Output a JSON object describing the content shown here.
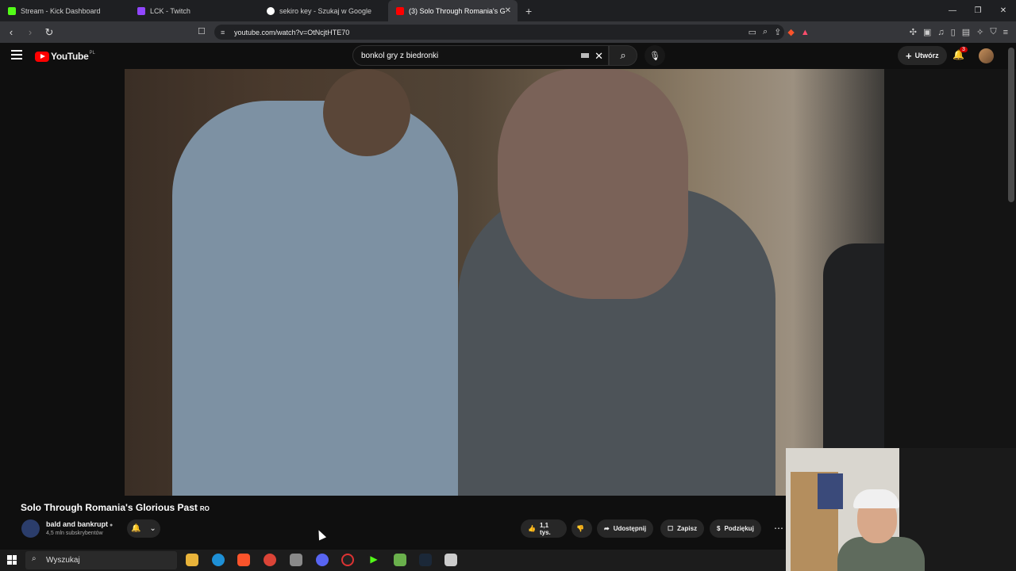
{
  "browser": {
    "tabs": [
      {
        "label": "Stream - Kick Dashboard",
        "favicon_color": "#53fc18"
      },
      {
        "label": "LCK - Twitch",
        "favicon_color": "#9146ff"
      },
      {
        "label": "sekiro key - Szukaj w Google",
        "favicon_color": "#ffffff"
      },
      {
        "label": "(3) Solo Through Romania's G",
        "favicon_color": "#ff0000"
      }
    ],
    "url": "youtube.com/watch?v=OtNcjtHTE70"
  },
  "youtube": {
    "logo_text": "YouTube",
    "region": "PL",
    "search_value": "bonkol gry z biedronki",
    "create_label": "Utwórz",
    "notif_count": "3"
  },
  "video": {
    "title": "Solo Through Romania's Glorious Past",
    "title_suffix": "RO",
    "channel_name": "bald and bankrupt",
    "subscribers": "4,5 mln subskrybentów",
    "likes": "1,1 tys.",
    "share_label": "Udostępnij",
    "save_label": "Zapisz",
    "thanks_label": "Podziękuj"
  },
  "taskbar": {
    "search_placeholder": "Wyszukaj"
  }
}
